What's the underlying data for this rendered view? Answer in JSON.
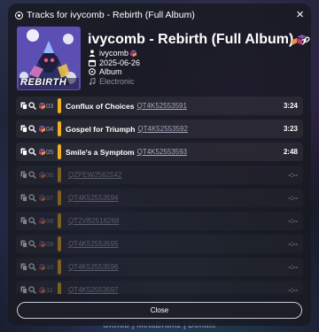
{
  "page": {
    "footer_text": "Github | MetaBrainz | Donate"
  },
  "modal": {
    "title": "Tracks for ivycomb - Rebirth (Full Album)",
    "close_icon": "×",
    "close_button_label": "Close"
  },
  "album": {
    "title": "ivycomb - Rebirth (Full Album)",
    "cover_text": "REBIRTH",
    "artist": "ivycomb",
    "date": "2025-06-26",
    "type": "Album",
    "genre": "Electronic",
    "icons": [
      "cube-icon",
      "link-icon",
      "user-icon",
      "calendar-icon",
      "disc-icon",
      "music-note-icon"
    ]
  },
  "tracks": [
    {
      "num": "03",
      "title": "Conflux of Choices",
      "isrc": "QT4K52553591",
      "duration": "3:24"
    },
    {
      "num": "04",
      "title": "Gospel for Triumph",
      "isrc": "QT4K52553592",
      "duration": "3:23"
    },
    {
      "num": "05",
      "title": "Smile's a Symptom",
      "isrc": "QT4K52553593",
      "duration": "2:48"
    },
    {
      "num": "06",
      "title": "",
      "isrc": "QZPEW2562542",
      "duration": "-:--"
    },
    {
      "num": "07",
      "title": "",
      "isrc": "QT4K52553594",
      "duration": "-:--"
    },
    {
      "num": "08",
      "title": "",
      "isrc": "QT2VB2516268",
      "duration": "-:--"
    },
    {
      "num": "09",
      "title": "",
      "isrc": "QT4K52553595",
      "duration": "-:--"
    },
    {
      "num": "10",
      "title": "",
      "isrc": "QT4K52553596",
      "duration": "-:--"
    },
    {
      "num": "11",
      "title": "",
      "isrc": "QT4K52553597",
      "duration": "-:--"
    }
  ],
  "track_icons": [
    "copy-icon",
    "search-icon",
    "cube-icon"
  ],
  "colors": {
    "accent_bar": "#f2b01e",
    "modal_bg": "#181a22"
  }
}
